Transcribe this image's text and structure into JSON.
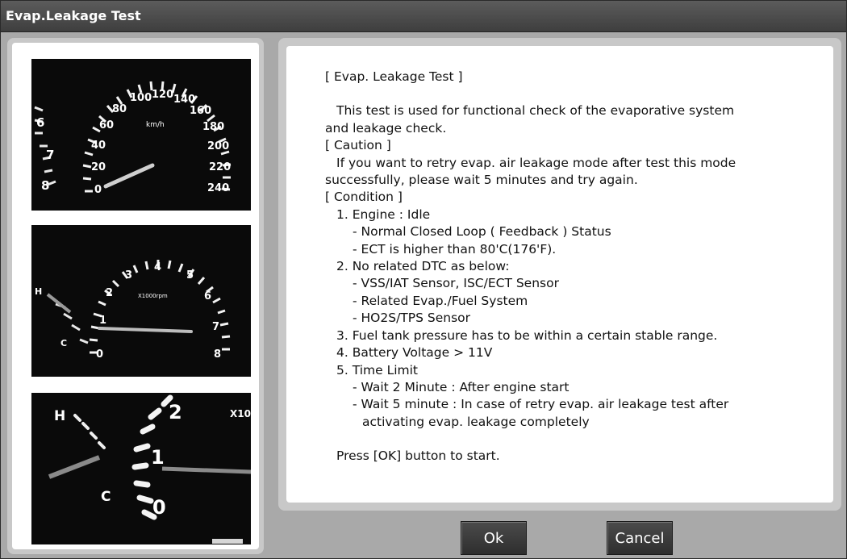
{
  "window": {
    "title": "Evap.Leakage Test"
  },
  "gauges": {
    "speedometer": {
      "ticks": [
        "6",
        "7",
        "8",
        "20",
        "40",
        "60",
        "80",
        "100",
        "120",
        "140",
        "160",
        "180",
        "200",
        "220",
        "240",
        "0"
      ],
      "unit": "km/h"
    },
    "tachometer": {
      "ticks": [
        "0",
        "1",
        "2",
        "3",
        "4",
        "5",
        "6",
        "7",
        "8"
      ],
      "unit": "X1000rpm",
      "temp_high": "H",
      "temp_low": "C"
    },
    "temperature": {
      "high": "H",
      "low": "C",
      "ticks": [
        "0",
        "1",
        "2"
      ],
      "unit_partial": "X10"
    }
  },
  "content": {
    "title": "[ Evap. Leakage Test ]",
    "intro": [
      "This test is used for functional check of the evaporative system",
      "and leakage check."
    ],
    "caution_header": "[ Caution ]",
    "caution": [
      "If you want to retry evap. air leakage mode after test this mode",
      "successfully, please wait 5 minutes and try again."
    ],
    "condition_header": "[ Condition ]",
    "conditions": [
      {
        "text": "1. Engine : Idle",
        "level": 1
      },
      {
        "text": "- Normal Closed Loop ( Feedback ) Status",
        "level": 2
      },
      {
        "text": "- ECT is higher than 80'C(176'F).",
        "level": 2
      },
      {
        "text": "2. No related DTC as below:",
        "level": 1
      },
      {
        "text": "- VSS/IAT Sensor, ISC/ECT Sensor",
        "level": 2
      },
      {
        "text": "- Related Evap./Fuel System",
        "level": 2
      },
      {
        "text": "- HO2S/TPS Sensor",
        "level": 2
      },
      {
        "text": "3. Fuel tank pressure has to be within a certain stable range.",
        "level": 1
      },
      {
        "text": "4. Battery Voltage > 11V",
        "level": 1
      },
      {
        "text": "5. Time Limit",
        "level": 1
      },
      {
        "text": "- Wait 2 Minute : After engine start",
        "level": 2
      },
      {
        "text": "- Wait 5 minute : In case of retry evap. air leakage test after",
        "level": 2
      },
      {
        "text": "activating evap. leakage completely",
        "level": 3
      }
    ],
    "prompt": "Press [OK] button to start."
  },
  "buttons": {
    "ok": "Ok",
    "cancel": "Cancel"
  }
}
